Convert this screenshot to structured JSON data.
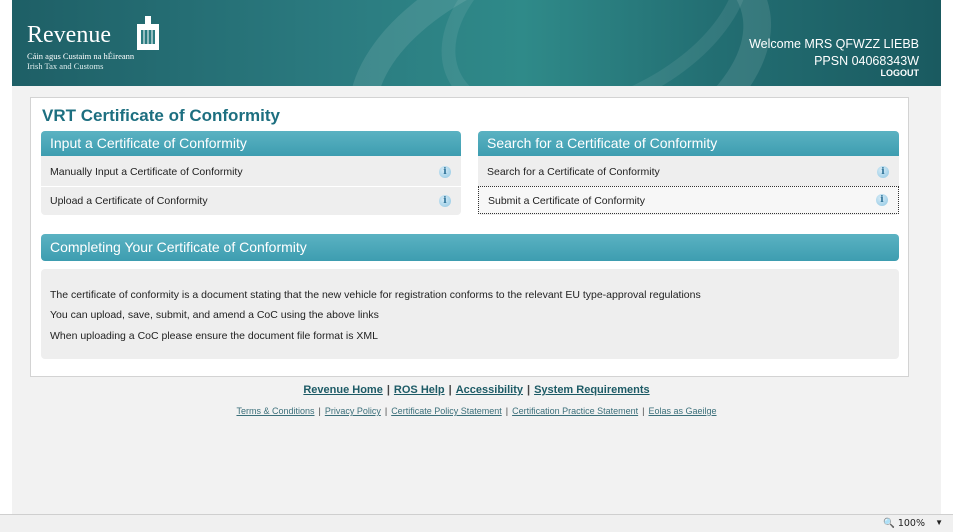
{
  "header": {
    "logo_word": "Revenue",
    "logo_sub1": "Cáin agus Custaim na hÉireann",
    "logo_sub2": "Irish Tax and Customs",
    "welcome": "Welcome MRS QFWZZ LIEBB",
    "ppsn": "PPSN 04068343W",
    "logout": "LOGOUT"
  },
  "page": {
    "title": "VRT Certificate of Conformity"
  },
  "input_panel": {
    "heading": "Input a Certificate of Conformity",
    "items": [
      {
        "label": "Manually Input a Certificate of Conformity",
        "icon": "info-icon"
      },
      {
        "label": "Upload a Certificate of Conformity",
        "icon": "info-icon"
      }
    ]
  },
  "search_panel": {
    "heading": "Search for a Certificate of Conformity",
    "items": [
      {
        "label": "Search for a Certificate of Conformity",
        "icon": "info-icon"
      },
      {
        "label": "Submit a Certificate of Conformity",
        "icon": "info-icon"
      }
    ]
  },
  "completing": {
    "heading": "Completing Your Certificate of Conformity",
    "lines": [
      "The certificate of conformity is a document stating that the new vehicle for registration conforms to the relevant EU type-approval regulations",
      "You can upload, save, submit, and amend a CoC using the above links",
      "When uploading a CoC please ensure the document file format is XML"
    ]
  },
  "footer": {
    "main_links": [
      "Revenue Home",
      "ROS Help",
      "Accessibility",
      "System Requirements"
    ],
    "sub_links": [
      "Terms & Conditions",
      "Privacy Policy",
      "Certificate Policy Statement",
      "Certification Practice Statement",
      "Eolas as Gaeilge"
    ],
    "separator": "|"
  },
  "statusbar": {
    "zoom": "100%"
  },
  "colors": {
    "header_teal": "#2b7b80",
    "panel_head": "#4aa7b9",
    "title_blue": "#1d6f80"
  }
}
